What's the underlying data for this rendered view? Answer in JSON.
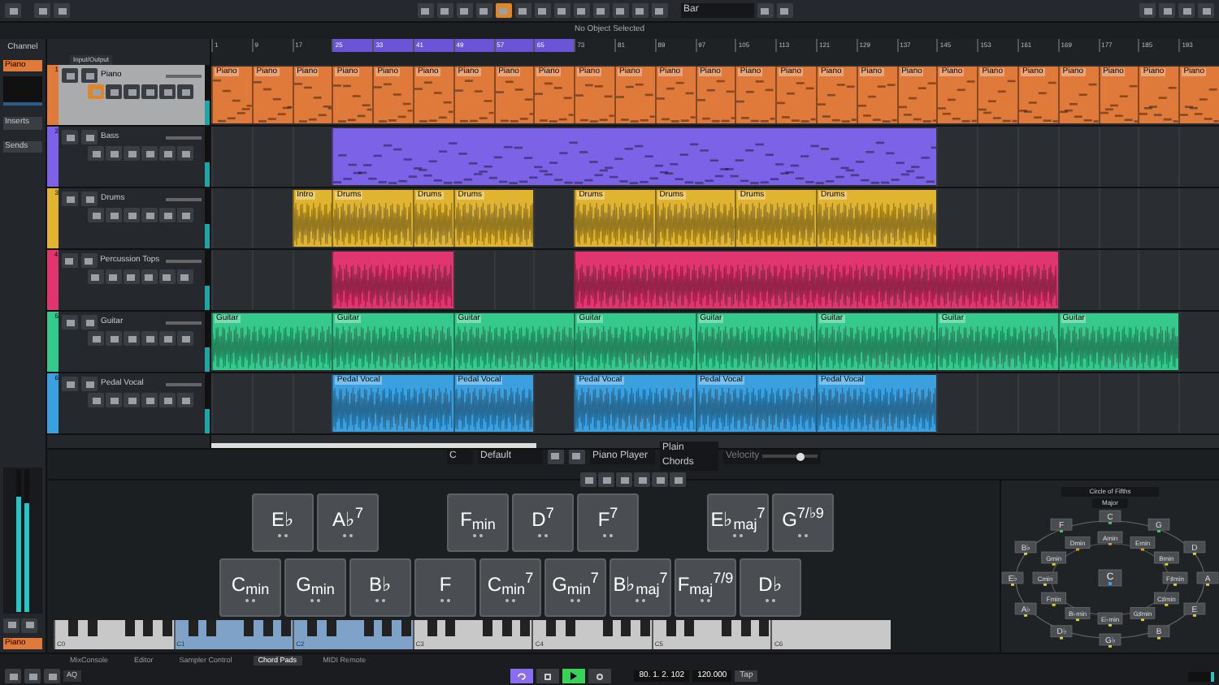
{
  "toolbar": {
    "snap": "Bar"
  },
  "info_line": "No Object Selected",
  "inspector": {
    "tab": "Channel",
    "track": "Piano",
    "sections": [
      "Inserts",
      "Sends"
    ],
    "channel_label": "Piano",
    "level": 0.8
  },
  "track_list": {
    "header": "Input/Output"
  },
  "ruler": [
    {
      "label": "1",
      "in_cycle": false
    },
    {
      "label": "9",
      "in_cycle": false
    },
    {
      "label": "17",
      "in_cycle": false
    },
    {
      "label": "25",
      "in_cycle": true
    },
    {
      "label": "33",
      "in_cycle": true
    },
    {
      "label": "41",
      "in_cycle": true
    },
    {
      "label": "49",
      "in_cycle": true
    },
    {
      "label": "57",
      "in_cycle": true
    },
    {
      "label": "65",
      "in_cycle": true
    },
    {
      "label": "73",
      "in_cycle": false
    },
    {
      "label": "81",
      "in_cycle": false
    },
    {
      "label": "89",
      "in_cycle": false
    },
    {
      "label": "97",
      "in_cycle": false
    },
    {
      "label": "105",
      "in_cycle": false
    },
    {
      "label": "113",
      "in_cycle": false
    },
    {
      "label": "121",
      "in_cycle": false
    },
    {
      "label": "129",
      "in_cycle": false
    },
    {
      "label": "137",
      "in_cycle": false
    },
    {
      "label": "145",
      "in_cycle": false
    },
    {
      "label": "153",
      "in_cycle": false
    },
    {
      "label": "161",
      "in_cycle": false
    },
    {
      "label": "169",
      "in_cycle": false
    },
    {
      "label": "177",
      "in_cycle": false
    },
    {
      "label": "185",
      "in_cycle": false
    },
    {
      "label": "193",
      "in_cycle": false
    }
  ],
  "tracks": [
    {
      "number": "1",
      "name": "Piano",
      "color": "#e07a3a",
      "kind": "midi",
      "selected": true,
      "cells": [
        {
          "kind": "clip",
          "label": "Piano"
        },
        {
          "kind": "clip",
          "label": "Piano"
        },
        {
          "kind": "clip",
          "label": "Piano"
        },
        {
          "kind": "clip",
          "label": "Piano"
        },
        {
          "kind": "clip",
          "label": "Piano"
        },
        {
          "kind": "clip",
          "label": "Piano"
        },
        {
          "kind": "clip",
          "label": "Piano"
        },
        {
          "kind": "clip",
          "label": "Piano"
        },
        {
          "kind": "clip",
          "label": "Piano"
        },
        {
          "kind": "clip",
          "label": "Piano"
        },
        {
          "kind": "clip",
          "label": "Piano"
        },
        {
          "kind": "clip",
          "label": "Piano"
        },
        {
          "kind": "clip",
          "label": "Piano"
        },
        {
          "kind": "clip",
          "label": "Piano"
        },
        {
          "kind": "clip",
          "label": "Piano"
        },
        {
          "kind": "clip",
          "label": "Piano"
        },
        {
          "kind": "clip",
          "label": "Piano"
        },
        {
          "kind": "clip",
          "label": "Piano"
        },
        {
          "kind": "clip",
          "label": "Piano"
        },
        {
          "kind": "clip",
          "label": "Piano"
        },
        {
          "kind": "clip",
          "label": "Piano"
        },
        {
          "kind": "clip",
          "label": "Piano"
        },
        {
          "kind": "clip",
          "label": "Piano"
        },
        {
          "kind": "clip",
          "label": "Piano"
        },
        {
          "kind": "clip",
          "label": "Piano"
        }
      ]
    },
    {
      "number": "2",
      "name": "Bass",
      "color": "#7b62e6",
      "kind": "midi",
      "selected": false,
      "cells": [
        {
          "kind": "gap"
        },
        {
          "kind": "gap"
        },
        {
          "kind": "gap"
        },
        {
          "kind": "clip"
        },
        {
          "kind": "clip"
        },
        {
          "kind": "clip"
        },
        {
          "kind": "clip"
        },
        {
          "kind": "clip"
        },
        {
          "kind": "clip"
        },
        {
          "kind": "clip"
        },
        {
          "kind": "clip"
        },
        {
          "kind": "clip"
        },
        {
          "kind": "clip"
        },
        {
          "kind": "clip"
        },
        {
          "kind": "clip"
        },
        {
          "kind": "clip"
        },
        {
          "kind": "clip"
        },
        {
          "kind": "clip"
        },
        {
          "kind": "gap"
        },
        {
          "kind": "gap"
        },
        {
          "kind": "gap"
        },
        {
          "kind": "gap"
        },
        {
          "kind": "gap"
        },
        {
          "kind": "gap"
        },
        {
          "kind": "gap"
        }
      ]
    },
    {
      "number": "3",
      "name": "Drums",
      "color": "#e0b430",
      "kind": "audio",
      "selected": false,
      "cells": [
        {
          "kind": "gap"
        },
        {
          "kind": "gap"
        },
        {
          "kind": "clip",
          "label": "Intro"
        },
        {
          "kind": "clip",
          "label": "Drums"
        },
        {
          "kind": "clip"
        },
        {
          "kind": "clip",
          "label": "Drums"
        },
        {
          "kind": "clip",
          "label": "Drums"
        },
        {
          "kind": "clip"
        },
        {
          "kind": "gap"
        },
        {
          "kind": "clip",
          "label": "Drums"
        },
        {
          "kind": "clip"
        },
        {
          "kind": "clip",
          "label": "Drums"
        },
        {
          "kind": "clip"
        },
        {
          "kind": "clip",
          "label": "Drums"
        },
        {
          "kind": "clip"
        },
        {
          "kind": "clip",
          "label": "Drums"
        },
        {
          "kind": "clip"
        },
        {
          "kind": "clip"
        },
        {
          "kind": "gap"
        },
        {
          "kind": "gap"
        },
        {
          "kind": "gap"
        },
        {
          "kind": "gap"
        },
        {
          "kind": "gap"
        },
        {
          "kind": "gap"
        },
        {
          "kind": "gap"
        }
      ]
    },
    {
      "number": "4",
      "name": "Percussion Tops",
      "color": "#e0356e",
      "kind": "audio",
      "selected": false,
      "cells": [
        {
          "kind": "gap"
        },
        {
          "kind": "gap"
        },
        {
          "kind": "gap"
        },
        {
          "kind": "clip"
        },
        {
          "kind": "clip"
        },
        {
          "kind": "clip"
        },
        {
          "kind": "gap"
        },
        {
          "kind": "gap"
        },
        {
          "kind": "gap"
        },
        {
          "kind": "clip"
        },
        {
          "kind": "clip"
        },
        {
          "kind": "clip"
        },
        {
          "kind": "clip"
        },
        {
          "kind": "clip"
        },
        {
          "kind": "clip"
        },
        {
          "kind": "clip"
        },
        {
          "kind": "clip"
        },
        {
          "kind": "clip"
        },
        {
          "kind": "clip"
        },
        {
          "kind": "clip"
        },
        {
          "kind": "clip"
        },
        {
          "kind": "gap"
        },
        {
          "kind": "gap"
        },
        {
          "kind": "gap"
        },
        {
          "kind": "gap"
        }
      ]
    },
    {
      "number": "5",
      "name": "Guitar",
      "color": "#36c98c",
      "kind": "audio",
      "selected": false,
      "cells": [
        {
          "kind": "clip",
          "label": "Guitar"
        },
        {
          "kind": "clip"
        },
        {
          "kind": "clip"
        },
        {
          "kind": "clip",
          "label": "Guitar"
        },
        {
          "kind": "clip"
        },
        {
          "kind": "clip"
        },
        {
          "kind": "clip",
          "label": "Guitar"
        },
        {
          "kind": "clip"
        },
        {
          "kind": "clip"
        },
        {
          "kind": "clip",
          "label": "Guitar"
        },
        {
          "kind": "clip"
        },
        {
          "kind": "clip"
        },
        {
          "kind": "clip",
          "label": "Guitar"
        },
        {
          "kind": "clip"
        },
        {
          "kind": "clip"
        },
        {
          "kind": "clip",
          "label": "Guitar"
        },
        {
          "kind": "clip"
        },
        {
          "kind": "clip"
        },
        {
          "kind": "clip",
          "label": "Guitar"
        },
        {
          "kind": "clip"
        },
        {
          "kind": "clip"
        },
        {
          "kind": "clip",
          "label": "Guitar"
        },
        {
          "kind": "clip"
        },
        {
          "kind": "clip"
        },
        {
          "kind": "gap"
        }
      ]
    },
    {
      "number": "6",
      "name": "Pedal Vocal",
      "color": "#3aa0e0",
      "kind": "audio",
      "selected": false,
      "cells": [
        {
          "kind": "gap"
        },
        {
          "kind": "gap"
        },
        {
          "kind": "gap"
        },
        {
          "kind": "clip",
          "label": "Pedal Vocal"
        },
        {
          "kind": "clip"
        },
        {
          "kind": "clip"
        },
        {
          "kind": "clip",
          "label": "Pedal Vocal"
        },
        {
          "kind": "clip"
        },
        {
          "kind": "gap"
        },
        {
          "kind": "clip",
          "label": "Pedal Vocal"
        },
        {
          "kind": "clip"
        },
        {
          "kind": "clip"
        },
        {
          "kind": "clip",
          "label": "Pedal Vocal"
        },
        {
          "kind": "clip"
        },
        {
          "kind": "clip"
        },
        {
          "kind": "clip",
          "label": "Pedal Vocal"
        },
        {
          "kind": "clip"
        },
        {
          "kind": "clip"
        },
        {
          "kind": "gap"
        },
        {
          "kind": "gap"
        },
        {
          "kind": "gap"
        },
        {
          "kind": "gap"
        },
        {
          "kind": "gap"
        },
        {
          "kind": "gap"
        },
        {
          "kind": "gap"
        }
      ]
    }
  ],
  "chord_toolbar": {
    "key": "C",
    "preset": "Default",
    "player": "Piano Player",
    "voicing": "Plain Chords",
    "velocity_label": "Velocity",
    "level": 0.7
  },
  "chord_pads": {
    "top_row": [
      {
        "kind": "pad",
        "label": "E♭"
      },
      {
        "kind": "pad",
        "label": "A♭$^{7}$"
      },
      {
        "kind": "empty"
      },
      {
        "kind": "pad",
        "label": "F$_{min}$"
      },
      {
        "kind": "pad",
        "label": "D$^{7}$"
      },
      {
        "kind": "pad",
        "label": "F$^{7}$"
      },
      {
        "kind": "empty"
      },
      {
        "kind": "pad",
        "label": "E♭$_{maj}$$^{7}$"
      },
      {
        "kind": "pad",
        "label": "G$^{7/♭9}$"
      }
    ],
    "bottom_row": [
      {
        "kind": "pad",
        "label": "C$_{min}$"
      },
      {
        "kind": "pad",
        "label": "G$_{min}$"
      },
      {
        "kind": "pad",
        "label": "B♭"
      },
      {
        "kind": "pad",
        "label": "F"
      },
      {
        "kind": "pad",
        "label": "C$_{min}$$^{7}$"
      },
      {
        "kind": "pad",
        "label": "G$_{min}$$^{7}$"
      },
      {
        "kind": "pad",
        "label": "B♭$_{maj}$$^{7}$"
      },
      {
        "kind": "pad",
        "label": "F$_{maj}$$^{7/9}$"
      },
      {
        "kind": "pad",
        "label": "D♭"
      }
    ]
  },
  "keyboard": [
    {
      "label": "C0",
      "highlighted": false
    },
    {
      "label": "C1",
      "highlighted": true
    },
    {
      "label": "C2",
      "highlighted": true
    },
    {
      "label": "C3",
      "highlighted": false
    },
    {
      "label": "C4",
      "highlighted": false
    },
    {
      "label": "C5",
      "highlighted": false
    },
    {
      "label": "C6",
      "highlighted": false
    }
  ],
  "circle": {
    "mode": "Circle of Fifths",
    "scale": "Major",
    "center": {
      "label": "C",
      "color": "#3aa0e0"
    },
    "outer": [
      {
        "label": "C",
        "color": "#3ad35a"
      },
      {
        "label": "G",
        "color": "#3ad35a"
      },
      {
        "label": "D",
        "color": "#e0d030"
      },
      {
        "label": "A",
        "color": "#e0d030"
      },
      {
        "label": "E",
        "color": "#e0d030"
      },
      {
        "label": "B",
        "color": "#e0d030"
      },
      {
        "label": "G♭",
        "color": "#e0d030"
      },
      {
        "label": "D♭",
        "color": "#e0d030"
      },
      {
        "label": "A♭",
        "color": "#e0d030"
      },
      {
        "label": "E♭",
        "color": "#e0d030"
      },
      {
        "label": "B♭",
        "color": "#e0d030"
      },
      {
        "label": "F",
        "color": "#3ad35a"
      }
    ],
    "inner": [
      {
        "label": "Amin",
        "color": "#e09a20"
      },
      {
        "label": "Emin",
        "color": "#e09a20"
      },
      {
        "label": "Bmin",
        "color": "#e0d030"
      },
      {
        "label": "F♯min",
        "color": "#e0d030"
      },
      {
        "label": "C♯min",
        "color": "#e0d030"
      },
      {
        "label": "G♯min",
        "color": "#e0d030"
      },
      {
        "label": "E♭min",
        "color": "#e0d030"
      },
      {
        "label": "B♭min",
        "color": "#e0d030"
      },
      {
        "label": "Fmin",
        "color": "#e0d030"
      },
      {
        "label": "Cmin",
        "color": "#e0d030"
      },
      {
        "label": "Gmin",
        "color": "#e0d030"
      },
      {
        "label": "Dmin",
        "color": "#e09a20"
      }
    ]
  },
  "bottom_tabs": [
    {
      "label": "MixConsole",
      "selected": false
    },
    {
      "label": "Editor",
      "selected": false
    },
    {
      "label": "Sampler Control",
      "selected": false
    },
    {
      "label": "Chord Pads",
      "selected": true
    },
    {
      "label": "MIDI Remote",
      "selected": false
    }
  ],
  "transport": {
    "quantize": "AQ",
    "cycle": true,
    "playing": true,
    "position": "80. 1. 2. 102",
    "tempo": "120.000",
    "tap": "Tap"
  }
}
